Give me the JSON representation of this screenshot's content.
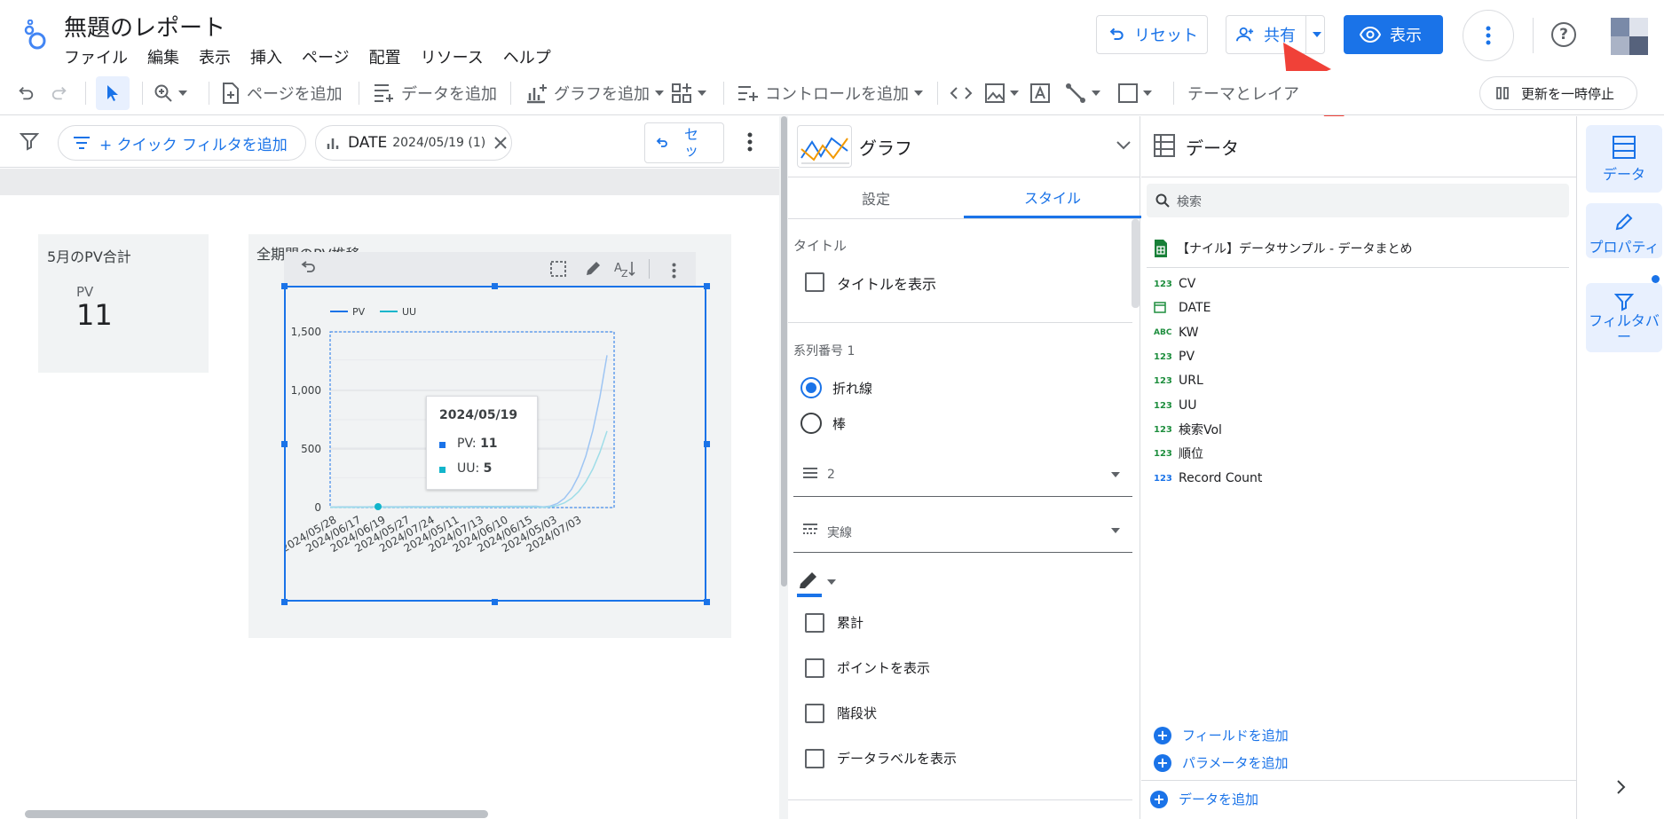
{
  "header": {
    "title": "無題のレポート",
    "menu": [
      "ファイル",
      "編集",
      "表示",
      "挿入",
      "ページ",
      "配置",
      "リソース",
      "ヘルプ"
    ],
    "reset_label": "リセット",
    "share_label": "共有",
    "view_label": "表示"
  },
  "toolbar": {
    "add_page": "ページを追加",
    "add_data": "データを追加",
    "add_chart": "グラフを追加",
    "add_control": "コントロールを追加",
    "theme_layout": "テーマとレイア",
    "pause_update": "更新を一時停止"
  },
  "filterbar": {
    "quick_filter": "+ クイック フィルタを追加",
    "date_chip_field": "DATE",
    "date_chip_value": "2024/05/19 (1)",
    "reset_short": "セ ッ"
  },
  "canvas": {
    "card1_title": "5月のPV合計",
    "card1_metric_label": "PV",
    "card1_metric_value": "11",
    "card2_title": "全期間のPV推移"
  },
  "chart_data": {
    "type": "line",
    "title": "全期間のPV推移",
    "series": [
      {
        "name": "PV",
        "color": "#1a73e8"
      },
      {
        "name": "UU",
        "color": "#12b5cb"
      }
    ],
    "yticks": [
      "1,500",
      "1,000",
      "500",
      "0"
    ],
    "ylim": [
      0,
      1500
    ],
    "xticks": [
      "2024/05/28",
      "2024/06/17",
      "2024/06/19",
      "2024/05/27",
      "2024/07/24",
      "2024/05/11",
      "2024/07/13",
      "2024/06/10",
      "2024/06/15",
      "2024/05/03",
      "2024/07/03"
    ],
    "tooltip": {
      "date": "2024/05/19",
      "pv_label": "PV:",
      "pv_value": "11",
      "uu_label": "UU:",
      "uu_value": "5"
    },
    "grid": true,
    "legend": "top-left"
  },
  "props": {
    "header_label": "グラフ",
    "tab_setup": "設定",
    "tab_style": "スタイル",
    "title_section": "タイトル",
    "show_title": "タイトルを表示",
    "series_section": "系列番号 1",
    "radio_line": "折れ線",
    "radio_bar": "棒",
    "line_weight": "2",
    "line_style": "実線",
    "cumulative": "累計",
    "show_points": "ポイントを表示",
    "stepped": "階段状",
    "show_data_labels": "データラベルを表示"
  },
  "datapanel": {
    "header": "データ",
    "search_placeholder": "検索",
    "source_name": "【ナイル】データサンプル - データまとめ",
    "fields": [
      {
        "type": "123",
        "name": "CV"
      },
      {
        "type": "cal",
        "name": "DATE"
      },
      {
        "type": "ABC",
        "name": "KW"
      },
      {
        "type": "123",
        "name": "PV"
      },
      {
        "type": "123",
        "name": "URL"
      },
      {
        "type": "123",
        "name": "UU"
      },
      {
        "type": "123",
        "name": "検索Vol"
      },
      {
        "type": "123",
        "name": "順位"
      },
      {
        "type": "123",
        "name": "Record Count"
      }
    ],
    "add_field": "フィールドを追加",
    "add_param": "パラメータを追加",
    "add_data": "データを追加"
  },
  "rail": {
    "data": "データ",
    "properties": "プロパティ",
    "filterbar": "フィルタバ ー"
  }
}
